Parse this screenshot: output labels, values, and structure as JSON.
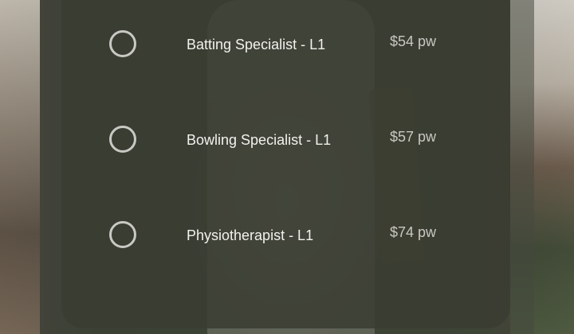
{
  "options": [
    {
      "label": "Batting Specialist - L1",
      "price": "$54 pw",
      "selected": false
    },
    {
      "label": "Bowling Specialist - L1",
      "price": "$57 pw",
      "selected": false
    },
    {
      "label": "Physiotherapist - L1",
      "price": "$74 pw",
      "selected": false
    }
  ],
  "icons": {
    "radio": "radio-unselected-icon"
  }
}
